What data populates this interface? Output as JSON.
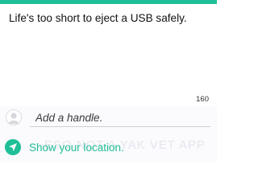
{
  "colors": {
    "accent": "#1fbf97"
  },
  "compose": {
    "text": "Life's too short to eject a USB safely."
  },
  "char_count": "160",
  "handle": {
    "placeholder": "Add a handle.",
    "value": ""
  },
  "location": {
    "label": "Show your location.",
    "icon": "location-arrow-icon"
  },
  "watermark": "ESO NOT A YAK VET APP"
}
